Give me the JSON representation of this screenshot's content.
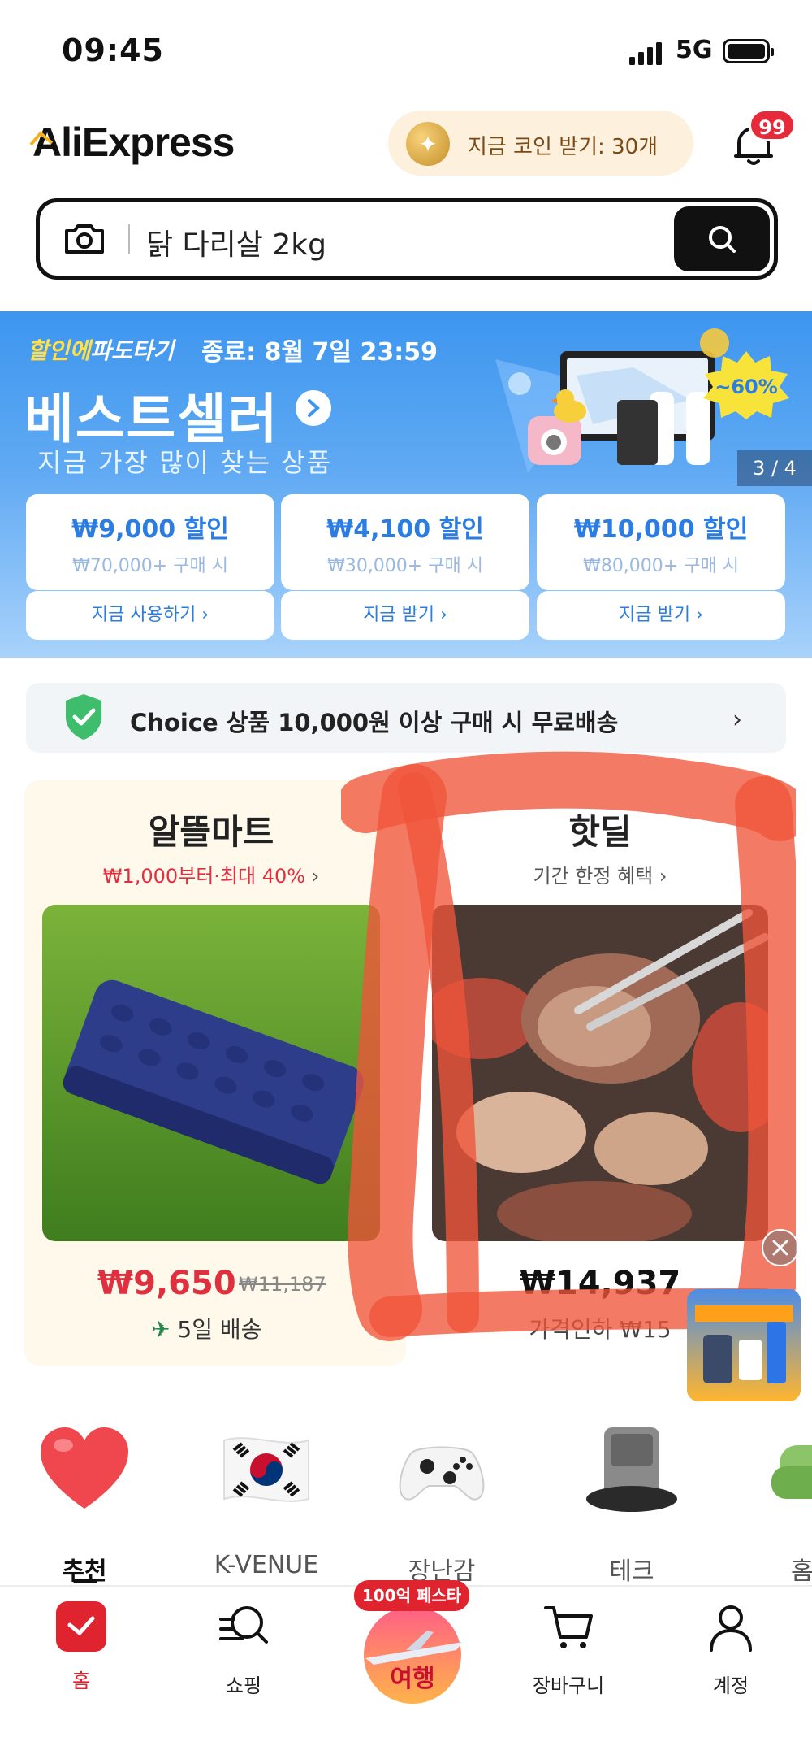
{
  "status_bar": {
    "time": "09:45",
    "network": "5G"
  },
  "header": {
    "logo": "AliExpress",
    "coin_text": "지금 코인 받기: 30개",
    "notification_count": "99"
  },
  "search": {
    "query": "닭 다리살 2kg"
  },
  "banner": {
    "tag_yellow": "할인에",
    "tag_white": "파도타기",
    "end_time": "종료: 8월 7일 23:59",
    "title": "베스트셀러",
    "subtitle": "지금 가장 많이 찾는 상품",
    "discount_badge": "~60%",
    "page_indicator": "3 / 4",
    "coupons": [
      {
        "amount": "₩9,000 할인",
        "condition": "₩70,000+ 구매 시",
        "action": "지금 사용하기"
      },
      {
        "amount": "₩4,100 할인",
        "condition": "₩30,000+ 구매 시",
        "action": "지금 받기"
      },
      {
        "amount": "₩10,000 할인",
        "condition": "₩80,000+ 구매 시",
        "action": "지금 받기"
      }
    ]
  },
  "choice": {
    "text": "Choice 상품 10,000원 이상 구매 시 무료배송"
  },
  "deals": {
    "left": {
      "title": "알뜰마트",
      "subtitle": "₩1,000부터·최대 40%",
      "price": "₩9,650",
      "original_price": "₩11,187",
      "shipping": "5일 배송"
    },
    "right": {
      "title": "핫딜",
      "subtitle": "기간 한정 혜택",
      "price": "₩14,937",
      "note": "가격인하 ₩15"
    }
  },
  "categories": [
    {
      "label": "추천",
      "icon": "heart-icon"
    },
    {
      "label": "K-VENUE",
      "icon": "korea-flag-icon"
    },
    {
      "label": "장난감",
      "icon": "gamepad-icon"
    },
    {
      "label": "테크",
      "icon": "robot-vacuum-icon"
    },
    {
      "label": "홈",
      "icon": "sofa-icon"
    }
  ],
  "bottom_nav": {
    "home": "홈",
    "shopping": "쇼핑",
    "travel_badge": "100억 페스타",
    "travel": "여행",
    "cart": "장바구니",
    "account": "계정"
  },
  "colors": {
    "accent_red": "#e62a3a",
    "coupon_blue": "#2b7de2",
    "banner_blue": "#3d96ef",
    "ship_green": "#1f8a4c"
  }
}
